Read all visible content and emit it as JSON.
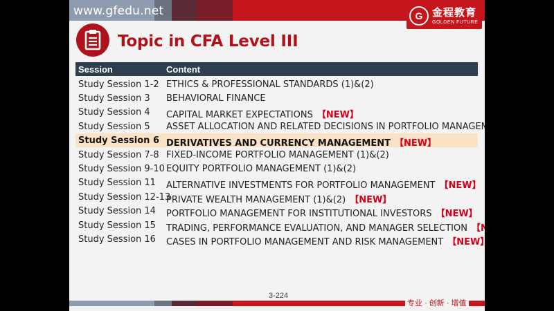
{
  "header": {
    "url": "www.gfedu.net",
    "logo_cn": "金程教育",
    "logo_en": "GOLDEN FUTURE",
    "colors": {
      "brand_red": "#c4161c",
      "header_dark": "#2e3e4f",
      "highlight_row": "#fbe1c6"
    }
  },
  "title": {
    "icon": "clipboard-icon",
    "text": "Topic in CFA Level III"
  },
  "table": {
    "headers": [
      "Session",
      "Content"
    ],
    "rows": [
      {
        "session": "Study Session 1-2",
        "content": "ETHICS & PROFESSIONAL STANDARDS (1)&(2)",
        "new": ""
      },
      {
        "session": "Study Session 3",
        "content": "BEHAVIORAL FINANCE",
        "new": ""
      },
      {
        "session": "Study Session 4",
        "content": "CAPITAL MARKET EXPECTATIONS",
        "new": "【NEW】"
      },
      {
        "session": "Study Session 5",
        "content": "ASSET ALLOCATION AND RELATED DECISIONS IN PORTFOLIO MANAGEMENT",
        "new": ""
      },
      {
        "session": "Study Session 6",
        "content": "DERIVATIVES AND CURRENCY MANAGEMENT",
        "new": "【NEW】",
        "highlight": true
      },
      {
        "session": "Study Session 7-8",
        "content": "FIXED-INCOME PORTFOLIO MANAGEMENT (1)&(2)",
        "new": ""
      },
      {
        "session": "Study Session 9-10",
        "content": "EQUITY PORTFOLIO MANAGEMENT (1)&(2)",
        "new": ""
      },
      {
        "session": "Study Session 11",
        "content": "ALTERNATIVE INVESTMENTS FOR PORTFOLIO MANAGEMENT",
        "new": "【NEW】"
      },
      {
        "session": "Study Session 12-13",
        "content": "PRIVATE WEALTH MANAGEMENT (1)&(2)",
        "new": "【NEW】"
      },
      {
        "session": "Study Session 14",
        "content": "PORTFOLIO MANAGEMENT FOR INSTITUTIONAL INVESTORS",
        "new": "【NEW】"
      },
      {
        "session": "Study Session 15",
        "content": "TRADING, PERFORMANCE EVALUATION, AND MANAGER SELECTION",
        "new": "【NEW】"
      },
      {
        "session": "Study Session 16",
        "content": "CASES IN PORTFOLIO MANAGEMENT AND RISK MANAGEMENT",
        "new": "【NEW】"
      }
    ]
  },
  "footer": {
    "page": "3-224",
    "slogan": "专业 · 创新 · 增值"
  }
}
